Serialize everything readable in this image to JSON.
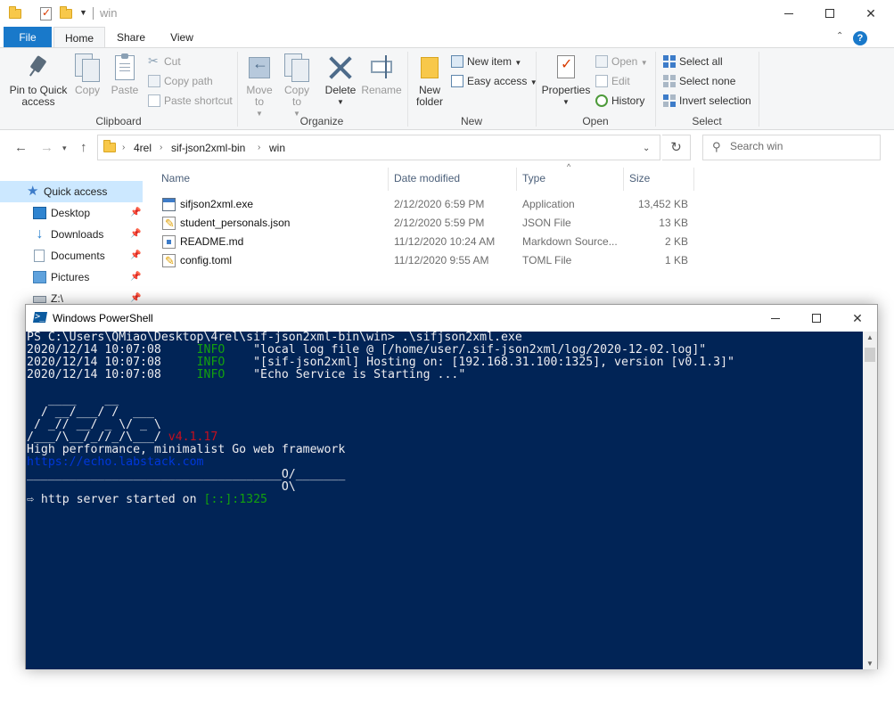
{
  "explorer": {
    "title": "win",
    "tabs": {
      "file": "File",
      "home": "Home",
      "share": "Share",
      "view": "View"
    },
    "ribbon": {
      "clipboard": {
        "label": "Clipboard",
        "pin": "Pin to Quick access",
        "copy": "Copy",
        "paste": "Paste",
        "cut": "Cut",
        "copy_path": "Copy path",
        "paste_shortcut": "Paste shortcut"
      },
      "organize": {
        "label": "Organize",
        "move_to": "Move to",
        "copy_to": "Copy to",
        "delete": "Delete",
        "rename": "Rename"
      },
      "new": {
        "label": "New",
        "new_folder": "New folder",
        "new_item": "New item",
        "easy_access": "Easy access"
      },
      "open": {
        "label": "Open",
        "properties": "Properties",
        "open": "Open",
        "edit": "Edit",
        "history": "History"
      },
      "select": {
        "label": "Select",
        "select_all": "Select all",
        "select_none": "Select none",
        "invert_selection": "Invert selection"
      }
    },
    "address": {
      "crumbs": [
        "4rel",
        "sif-json2xml-bin",
        "win"
      ]
    },
    "search": {
      "placeholder": "Search win"
    },
    "nav": {
      "items": [
        {
          "label": "Quick access",
          "icon": "star-icon"
        },
        {
          "label": "Desktop",
          "icon": "desktop-icon"
        },
        {
          "label": "Downloads",
          "icon": "download-icon"
        },
        {
          "label": "Documents",
          "icon": "documents-icon"
        },
        {
          "label": "Pictures",
          "icon": "pictures-icon"
        },
        {
          "label": "Z:\\",
          "icon": "drive-icon"
        }
      ]
    },
    "columns": {
      "name": "Name",
      "date": "Date modified",
      "type": "Type",
      "size": "Size"
    },
    "files": [
      {
        "name": "sifjson2xml.exe",
        "date": "2/12/2020 6:59 PM",
        "type": "Application",
        "size": "13,452 KB",
        "icon": "exe-icon"
      },
      {
        "name": "student_personals.json",
        "date": "2/12/2020 5:59 PM",
        "type": "JSON File",
        "size": "13 KB",
        "icon": "json-file-icon"
      },
      {
        "name": "README.md",
        "date": "11/12/2020 10:24 AM",
        "type": "Markdown Source...",
        "size": "2 KB",
        "icon": "markdown-file-icon"
      },
      {
        "name": "config.toml",
        "date": "11/12/2020 9:55 AM",
        "type": "TOML File",
        "size": "1 KB",
        "icon": "toml-file-icon"
      }
    ]
  },
  "powershell": {
    "title": "Windows PowerShell",
    "prompt": "PS C:\\Users\\QMiao\\Desktop\\4rel\\sif-json2xml-bin\\win> .\\sifjson2xml.exe",
    "log": [
      {
        "ts": "2020/12/14 10:07:08",
        "level": "INFO",
        "msg": "\"local log file @ [/home/user/.sif-json2xml/log/2020-12-02.log]\""
      },
      {
        "ts": "2020/12/14 10:07:08",
        "level": "INFO",
        "msg": "\"[sif-json2xml] Hosting on: [192.168.31.100:1325], version [v0.1.3]\""
      },
      {
        "ts": "2020/12/14 10:07:08",
        "level": "INFO",
        "msg": "\"Echo Service is Starting ...\""
      }
    ],
    "banner": {
      "art": [
        "   ____    __",
        "  / __/___/ /  ___",
        " / _// __/ _ \\/ _ \\",
        "/___/\\__/_//_/\\___/ "
      ],
      "version": "v4.1.17",
      "tagline": "High performance, minimalist Go web framework",
      "url": "https://echo.labstack.com",
      "rule1": "____________________________________O/_______",
      "rule2": "                                    O\\"
    },
    "server": {
      "glyph": "⇨",
      "text": " http server started on ",
      "address": "[::]:1325"
    },
    "colors": {
      "background": "#012456",
      "info": "#13a10e",
      "version": "#c50f1f",
      "url": "#0037da",
      "address": "#13a10e"
    }
  }
}
